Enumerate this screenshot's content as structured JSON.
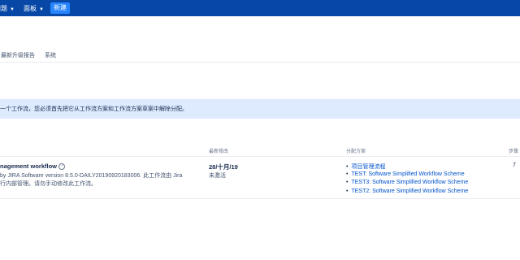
{
  "nav": {
    "issues": "问题",
    "dashboards": "面板",
    "create": "新建"
  },
  "subtabs": {
    "latest_upgrade_report": "最新升级报告",
    "system": "系统"
  },
  "info_message": "一个工作流，您必须首先把它从工作流方案和工作流方案草案中解除分配。",
  "table": {
    "headers": {
      "last_modified": "最新修改",
      "assigned_schemes": "分配方案",
      "steps": "步骤"
    },
    "row": {
      "name": "nagement workflow",
      "desc_line1": "by JIRA Software version 8.5.0-DAILY20190920183006. 此工作流由 Jira",
      "desc_line2": "行内部管理。请勿手动修改此工作流。",
      "date": "28/十月/19",
      "user": "未激活",
      "schemes": [
        "项目管理流程",
        "TEST: Software Simplified Workflow Scheme",
        "TEST3: Software Simplified Workflow Scheme",
        "TEST2: Software Simplified Workflow Scheme"
      ],
      "steps": "7"
    }
  },
  "colors": {
    "topbar": "#0747a6",
    "create_button": "#2684ff",
    "info_banner": "#deebff",
    "link": "#0052cc"
  }
}
